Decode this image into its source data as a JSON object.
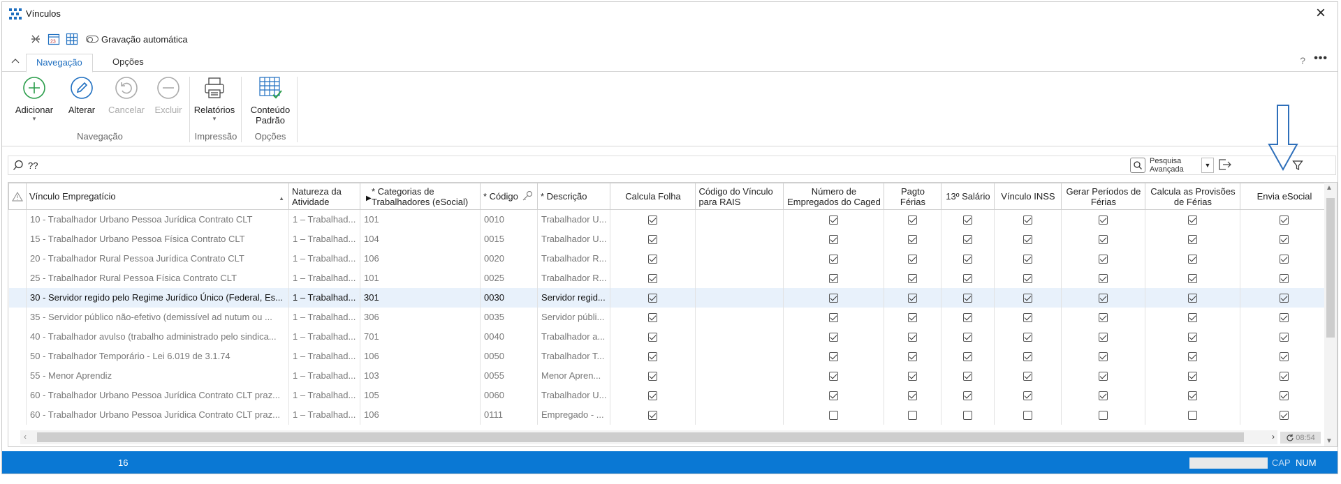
{
  "window": {
    "title": "Vínculos",
    "close": "×"
  },
  "quick_access": {
    "autosave_label": "Gravação automática"
  },
  "tabs": [
    {
      "label": "Navegação",
      "active": true
    },
    {
      "label": "Opções",
      "active": false
    }
  ],
  "help_label": "?",
  "more_label": "•••",
  "ribbon": {
    "buttons": {
      "add": "Adicionar",
      "edit": "Alterar",
      "cancel": "Cancelar",
      "delete": "Excluir",
      "reports": "Relatórios",
      "default_content_1": "Conteúdo",
      "default_content_2": "Padrão"
    },
    "groups": {
      "nav": "Navegação",
      "print": "Impressão",
      "options": "Opções"
    }
  },
  "search": {
    "value": "??",
    "advanced_1": "Pesquisa",
    "advanced_2": "Avançada"
  },
  "grid": {
    "headers": {
      "vinculo": "Vínculo Empregatício",
      "natureza": "Natureza da Atividade",
      "categorias": "* Categorias  de Trabalhadores (eSocial)",
      "codigo": "* Código",
      "descricao": "* Descrição",
      "calcula_folha": "Calcula Folha",
      "codigo_rais": "Código do Vínculo para RAIS",
      "numero_caged": "Número de Empregados do Caged",
      "pagto_ferias": "Pagto Férias",
      "salario13": "13º Salário",
      "vinculo_inss": "Vínculo INSS",
      "gerar_periodos": "Gerar Períodos de Férias",
      "calcula_provisoes": "Calcula as Provisões de Férias",
      "envia_esocial": "Envia eSocial"
    },
    "rows": [
      {
        "vinculo": "10 - Trabalhador Urbano Pessoa Jurídica Contrato CLT",
        "natureza": "1 – Trabalhad...",
        "categoria": "101",
        "codigo": "0010",
        "descricao": "Trabalhador U...",
        "checks": [
          1,
          1,
          1,
          1,
          1,
          1,
          1,
          1
        ],
        "selected": false
      },
      {
        "vinculo": "15 - Trabalhador Urbano Pessoa Física Contrato CLT",
        "natureza": "1 – Trabalhad...",
        "categoria": "104",
        "codigo": "0015",
        "descricao": "Trabalhador U...",
        "checks": [
          1,
          1,
          1,
          1,
          1,
          1,
          1,
          1
        ],
        "selected": false
      },
      {
        "vinculo": "20 - Trabalhador Rural Pessoa Jurídica Contrato CLT",
        "natureza": "1 – Trabalhad...",
        "categoria": "106",
        "codigo": "0020",
        "descricao": "Trabalhador R...",
        "checks": [
          1,
          1,
          1,
          1,
          1,
          1,
          1,
          1
        ],
        "selected": false
      },
      {
        "vinculo": "25 - Trabalhador Rural Pessoa Física Contrato CLT",
        "natureza": "1 – Trabalhad...",
        "categoria": "101",
        "codigo": "0025",
        "descricao": "Trabalhador R...",
        "checks": [
          1,
          1,
          1,
          1,
          1,
          1,
          1,
          1
        ],
        "selected": false
      },
      {
        "vinculo": "30 - Servidor regido pelo Regime Jurídico Único (Federal, Es...",
        "natureza": "1 – Trabalhad...",
        "categoria": "301",
        "codigo": "0030",
        "descricao": "Servidor regid...",
        "checks": [
          1,
          1,
          1,
          1,
          1,
          1,
          1,
          1
        ],
        "selected": true
      },
      {
        "vinculo": "35 - Servidor público não-efetivo (demissível ad nutum ou ...",
        "natureza": "1 – Trabalhad...",
        "categoria": "306",
        "codigo": "0035",
        "descricao": "Servidor públi...",
        "checks": [
          1,
          1,
          1,
          1,
          1,
          1,
          1,
          1
        ],
        "selected": false
      },
      {
        "vinculo": "40 - Trabalhador avulso (trabalho administrado pelo sindica...",
        "natureza": "1 – Trabalhad...",
        "categoria": "701",
        "codigo": "0040",
        "descricao": "Trabalhador a...",
        "checks": [
          1,
          1,
          1,
          1,
          1,
          1,
          1,
          1
        ],
        "selected": false
      },
      {
        "vinculo": "50 - Trabalhador Temporário - Lei 6.019 de 3.1.74",
        "natureza": "1 – Trabalhad...",
        "categoria": "106",
        "codigo": "0050",
        "descricao": "Trabalhador T...",
        "checks": [
          1,
          1,
          1,
          1,
          1,
          1,
          1,
          1
        ],
        "selected": false
      },
      {
        "vinculo": "55 - Menor Aprendiz",
        "natureza": "1 – Trabalhad...",
        "categoria": "103",
        "codigo": "0055",
        "descricao": "Menor Apren...",
        "checks": [
          1,
          1,
          1,
          1,
          1,
          1,
          1,
          1
        ],
        "selected": false
      },
      {
        "vinculo": "60 - Trabalhador Urbano Pessoa Jurídica Contrato CLT praz...",
        "natureza": "1 – Trabalhad...",
        "categoria": "105",
        "codigo": "0060",
        "descricao": "Trabalhador U...",
        "checks": [
          1,
          1,
          1,
          1,
          1,
          1,
          1,
          1
        ],
        "selected": false
      },
      {
        "vinculo": "60 - Trabalhador Urbano Pessoa Jurídica Contrato CLT praz...",
        "natureza": "1 – Trabalhad...",
        "categoria": "106",
        "codigo": "0111",
        "descricao": "Empregado - ...",
        "checks": [
          1,
          0,
          0,
          0,
          0,
          0,
          0,
          1
        ],
        "selected": false
      }
    ]
  },
  "refresh_time": "08:54",
  "status": {
    "count": "16",
    "cap": "CAP",
    "num": "NUM"
  },
  "colors": {
    "accent": "#1f6fc0",
    "statusbar": "#0a78d4",
    "selected_row": "#e8f1fb"
  }
}
